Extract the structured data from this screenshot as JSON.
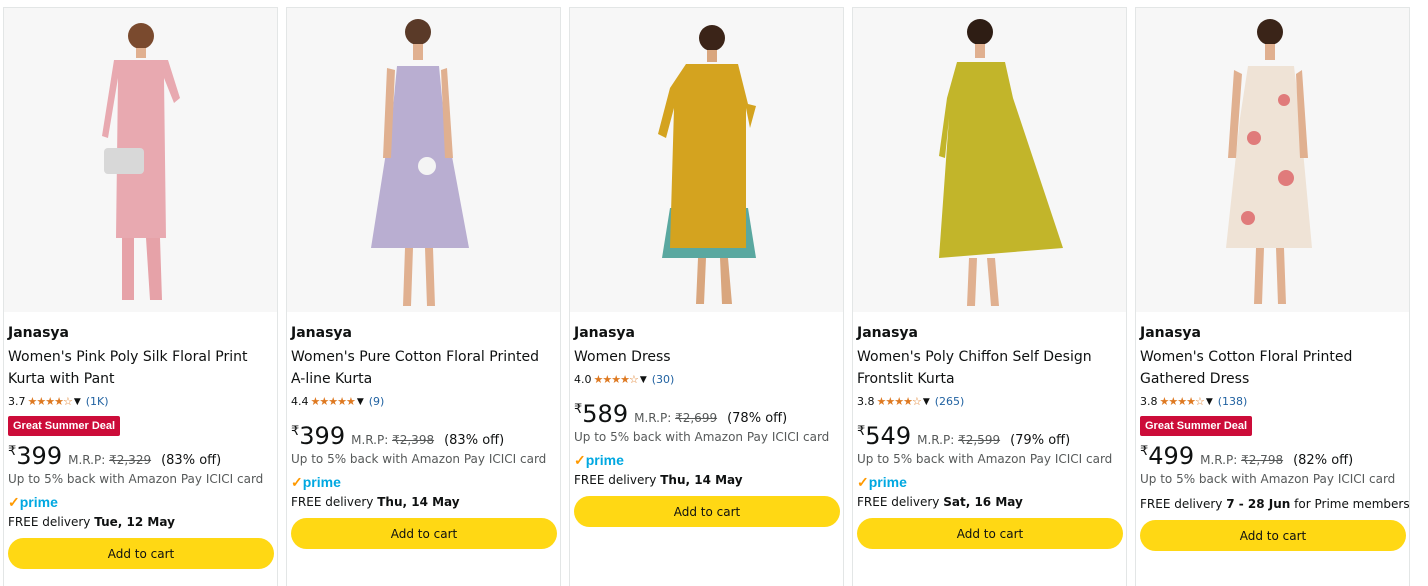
{
  "products": [
    {
      "brand": "Janasya",
      "title": "Women's Pink Poly Silk Floral Print Kurta with Pant",
      "rating": "3.7",
      "stars": "★★★★☆",
      "review_count": "(1K)",
      "deal_badge": "Great Summer Deal",
      "currency": "₹",
      "price": "399",
      "mrp_label": "M.R.P: ",
      "mrp": "₹2,329",
      "discount": "(83% off)",
      "cashback": "Up to 5% back with Amazon Pay ICICI card",
      "prime_label": "prime",
      "delivery_prefix": "FREE delivery ",
      "delivery_date": "Tue, 12 May",
      "delivery_suffix": "",
      "button_label": "Add to cart"
    },
    {
      "brand": "Janasya",
      "title": "Women's Pure Cotton Floral Printed A-line Kurta",
      "rating": "4.4",
      "stars": "★★★★★",
      "review_count": "(9)",
      "deal_badge": "",
      "currency": "₹",
      "price": "399",
      "mrp_label": "M.R.P: ",
      "mrp": "₹2,398",
      "discount": "(83% off)",
      "cashback": "Up to 5% back with Amazon Pay ICICI card",
      "prime_label": "prime",
      "delivery_prefix": "FREE delivery ",
      "delivery_date": "Thu, 14 May",
      "delivery_suffix": "",
      "button_label": "Add to cart"
    },
    {
      "brand": "Janasya",
      "title": "Women Dress",
      "rating": "4.0",
      "stars": "★★★★☆",
      "review_count": "(30)",
      "deal_badge": "",
      "currency": "₹",
      "price": "589",
      "mrp_label": "M.R.P: ",
      "mrp": "₹2,699",
      "discount": "(78% off)",
      "cashback": "Up to 5% back with Amazon Pay ICICI card",
      "prime_label": "prime",
      "delivery_prefix": "FREE delivery ",
      "delivery_date": "Thu, 14 May",
      "delivery_suffix": "",
      "button_label": "Add to cart"
    },
    {
      "brand": "Janasya",
      "title": "Women's Poly Chiffon Self Design Frontslit Kurta",
      "rating": "3.8",
      "stars": "★★★★☆",
      "review_count": "(265)",
      "deal_badge": "",
      "currency": "₹",
      "price": "549",
      "mrp_label": "M.R.P: ",
      "mrp": "₹2,599",
      "discount": "(79% off)",
      "cashback": "Up to 5% back with Amazon Pay ICICI card",
      "prime_label": "prime",
      "delivery_prefix": "FREE delivery ",
      "delivery_date": "Sat, 16 May",
      "delivery_suffix": "",
      "button_label": "Add to cart"
    },
    {
      "brand": "Janasya",
      "title": "Women's Cotton Floral Printed Gathered Dress",
      "rating": "3.8",
      "stars": "★★★★☆",
      "review_count": "(138)",
      "deal_badge": "Great Summer Deal",
      "currency": "₹",
      "price": "499",
      "mrp_label": "M.R.P: ",
      "mrp": "₹2,798",
      "discount": "(82% off)",
      "cashback": "Up to 5% back with Amazon Pay ICICI card",
      "prime_label": "",
      "delivery_prefix": "FREE delivery ",
      "delivery_date": "7 - 28 Jun",
      "delivery_suffix": " for Prime members",
      "button_label": "Add to cart"
    }
  ],
  "colors": {
    "button": "#ffd814",
    "deal_badge": "#cc0c39",
    "star": "#de7921",
    "link": "#2162a1",
    "prime": "#00a8e1",
    "garment_colors": [
      "#e8a9b0",
      "#b9aed1",
      "#d4a31f",
      "#c2b52a",
      "#efe3d6"
    ]
  }
}
